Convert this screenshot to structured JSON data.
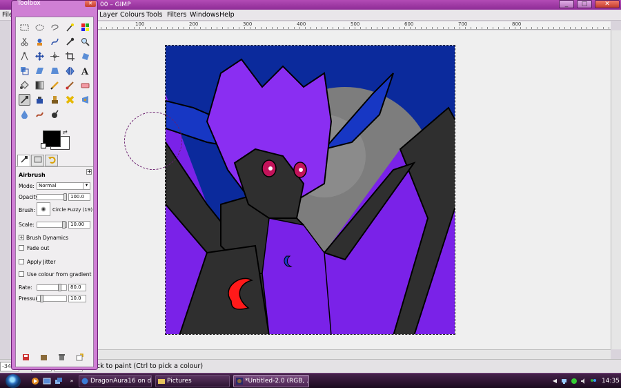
{
  "window": {
    "title": "00 – GIMP",
    "minimize": "_",
    "maximize": "□",
    "close": "✕"
  },
  "menu": {
    "items": [
      "File",
      "Layer",
      "Colours",
      "Tools",
      "Filters",
      "Windows",
      "Help"
    ]
  },
  "rulers": {
    "labels": [
      "100",
      "200",
      "300",
      "400",
      "500",
      "600",
      "700",
      "800"
    ]
  },
  "toolbox": {
    "title": "Toolbox",
    "close": "✕",
    "tools": [
      "rect-select",
      "ellipse-select",
      "free-select",
      "fuzzy-select",
      "by-color-select",
      "scissors-select",
      "foreground-select",
      "paths",
      "color-picker",
      "zoom",
      "measure",
      "move",
      "align",
      "crop",
      "rotate",
      "scale",
      "shear",
      "perspective",
      "flip",
      "text",
      "bucket-fill",
      "blend",
      "pencil",
      "paintbrush",
      "eraser",
      "airbrush",
      "ink",
      "clone",
      "heal",
      "perspective-clone",
      "blur",
      "smudge",
      "dodge-burn"
    ],
    "tabs": [
      "tool-options-tab",
      "device-status-tab",
      "undo-history-tab"
    ]
  },
  "tool_options": {
    "tool_name": "Airbrush",
    "mode_label": "Mode:",
    "mode_value": "Normal",
    "opacity_label": "Opacity:",
    "opacity_value": "100.0",
    "brush_label": "Brush:",
    "brush_name": "Circle Fuzzy (19)",
    "scale_label": "Scale:",
    "scale_value": "10.00",
    "brush_dynamics": "Brush Dynamics",
    "fade_out": "Fade out",
    "apply_jitter": "Apply Jitter",
    "use_gradient": "Use colour from gradient",
    "rate_label": "Rate:",
    "rate_value": "80.0",
    "pressure_label": "Pressure:",
    "pressure_value": "10.0"
  },
  "statusbar": {
    "coords": "-34",
    "message": "Click to paint (Ctrl to pick a colour)"
  },
  "taskbar": {
    "tasks": [
      {
        "label": "DragonAura16 on d...",
        "active": false
      },
      {
        "label": "Pictures",
        "active": false
      },
      {
        "label": "*Untitled-2.0 (RGB, ...",
        "active": true
      }
    ],
    "clock": "14:35"
  },
  "colors": {
    "foreground": "#000000",
    "background": "#ffffff",
    "title_accent": "#a23ca8"
  }
}
